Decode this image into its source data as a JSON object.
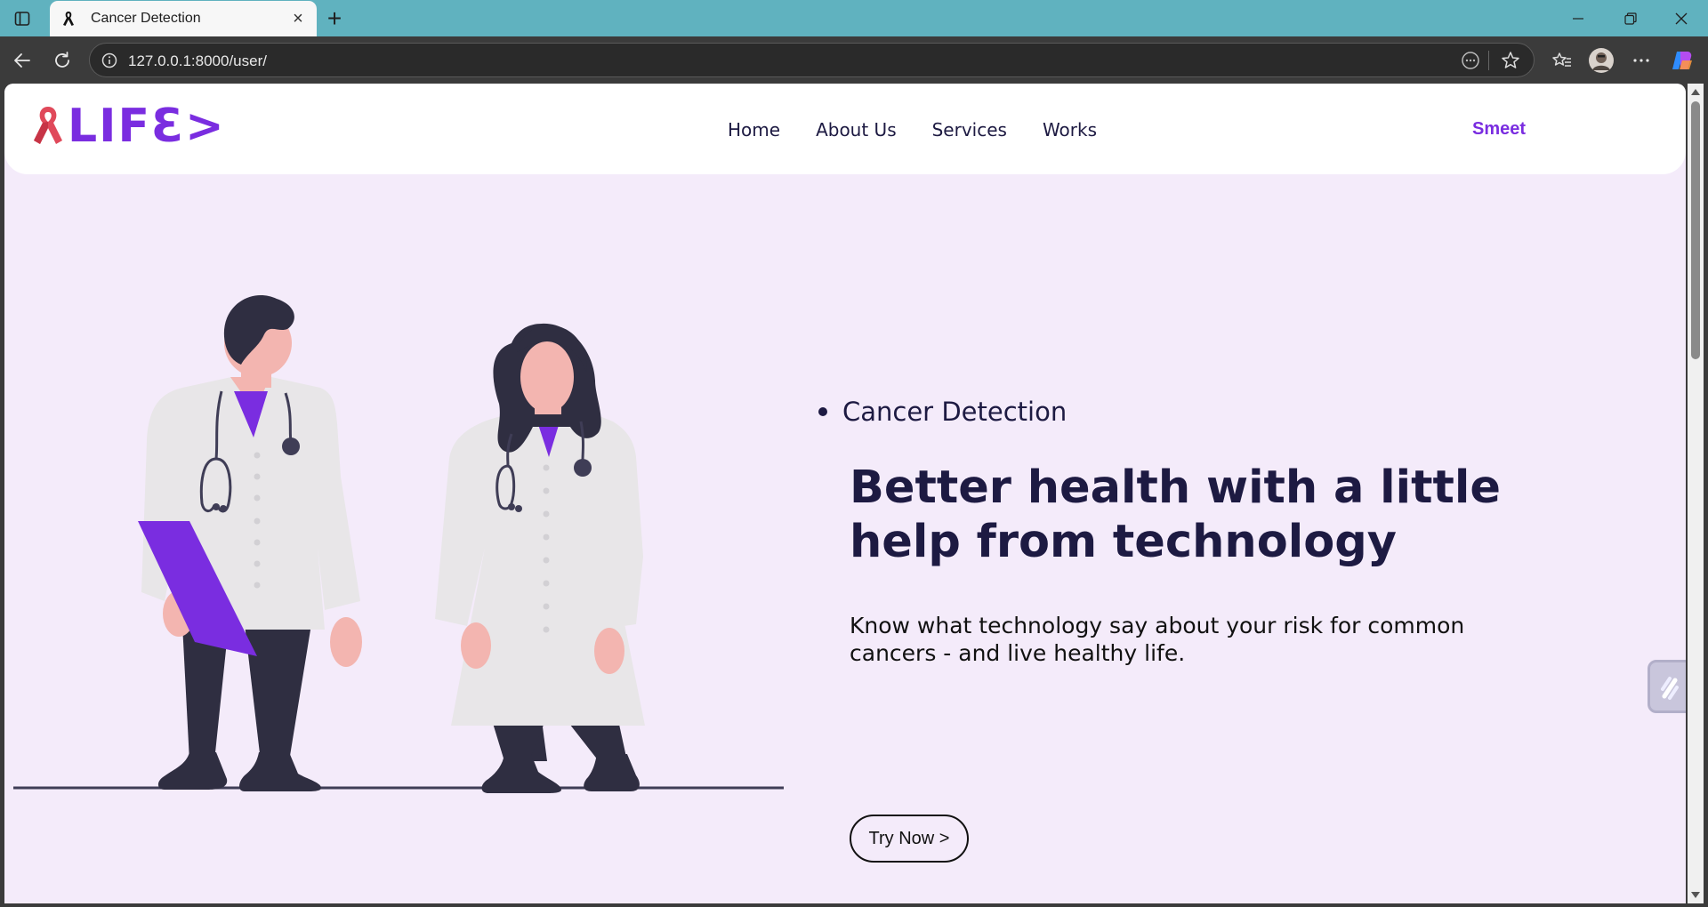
{
  "browser": {
    "tab_title": "Cancer Detection",
    "tab_close_glyph": "×",
    "new_tab_glyph": "+",
    "url": "127.0.0.1:8000/user/",
    "icons": [
      "sidebar-toggle-icon",
      "ribbon-favicon-icon",
      "back-icon",
      "refresh-icon",
      "info-icon",
      "reader-icon",
      "star-icon",
      "favorites-icon",
      "profile-avatar-icon",
      "more-icon",
      "copilot-icon",
      "minimize-icon",
      "restore-icon",
      "close-icon"
    ]
  },
  "site": {
    "logo_text": "LIFƐ>",
    "brand_color": "#7a2de0",
    "nav": [
      "Home",
      "About Us",
      "Services",
      "Works"
    ],
    "user_name": "Smeet"
  },
  "hero": {
    "bullet": "Cancer Detection",
    "title": "Better health with a little help from technology",
    "text": "Know what technology say about your risk for common cancers - and live healthy life.",
    "cta": "Try Now >"
  },
  "colors": {
    "page_bg": "#f4ebfa",
    "heading": "#1d1a42",
    "accent": "#7a2de0",
    "skin": "#f3b5b0",
    "coat": "#e8e6e8",
    "dark": "#2f2e41",
    "ribbon": "#e0495a"
  }
}
